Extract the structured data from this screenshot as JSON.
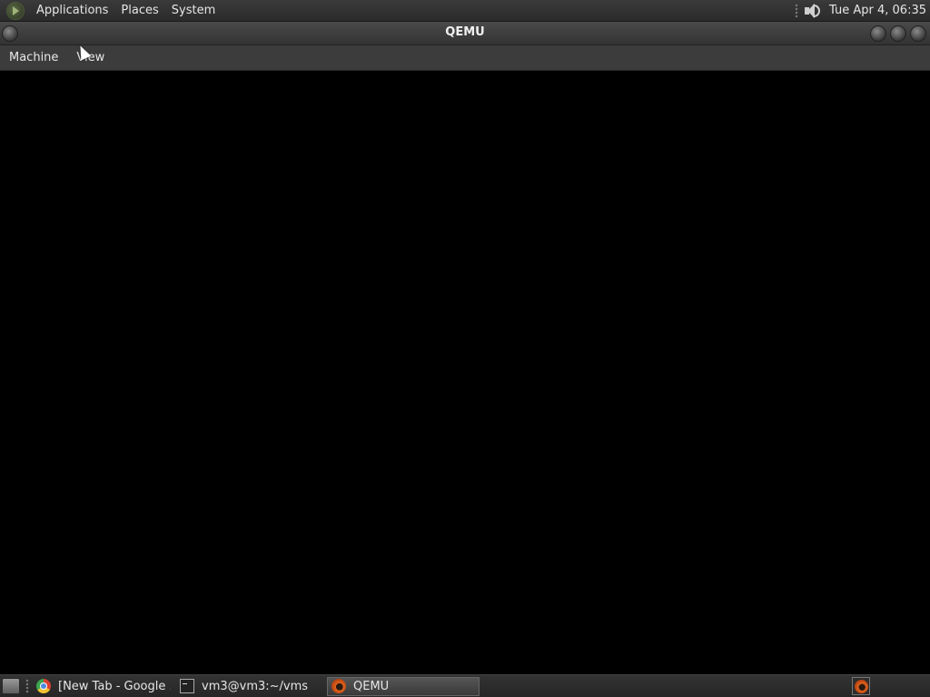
{
  "top_panel": {
    "menus": [
      "Applications",
      "Places",
      "System"
    ],
    "clock": "Tue Apr  4, 06:35"
  },
  "window": {
    "title": "QEMU",
    "menus": [
      "Machine",
      "View"
    ]
  },
  "taskbar": {
    "tasks": [
      {
        "label": "[New Tab - Google ...",
        "icon": "chrome-icon"
      },
      {
        "label": "vm3@vm3:~/vms",
        "icon": "terminal-icon"
      },
      {
        "label": "QEMU",
        "icon": "qemu-icon"
      }
    ]
  }
}
